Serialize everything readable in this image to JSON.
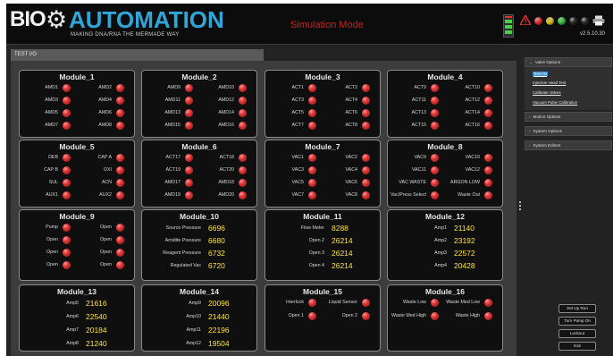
{
  "header": {
    "logo_bio": "BIO",
    "logo_automation": "AUTOMATION",
    "logo_tagline": "MAKING DNA/RNA THE MERMADE WAY",
    "mode": "Simulation Mode",
    "version": "v2.5.10.30",
    "status_colors": [
      "#e63030",
      "#e0c020",
      "#36c236",
      "#2a2a2a",
      "#2a2a2a"
    ]
  },
  "toolbar": {
    "tab_label": "TEST I/O"
  },
  "modules": [
    {
      "title": "Module_1",
      "rows": [
        [
          "AMD1",
          "AMD2"
        ],
        [
          "AMD3",
          "AMD4"
        ],
        [
          "AMD5",
          "AMD6"
        ],
        [
          "AMD7",
          "AMD8"
        ]
      ]
    },
    {
      "title": "Module_2",
      "rows": [
        [
          "AMD9",
          "AMD10"
        ],
        [
          "AMD11",
          "AMD12"
        ],
        [
          "AMD13",
          "AMD14"
        ],
        [
          "AMD15",
          "AMD16"
        ]
      ]
    },
    {
      "title": "Module_3",
      "rows": [
        [
          "ACT1",
          "ACT2"
        ],
        [
          "ACT3",
          "ACT4"
        ],
        [
          "ACT5",
          "ACT6"
        ],
        [
          "ACT7",
          "ACT8"
        ]
      ]
    },
    {
      "title": "Module_4",
      "rows": [
        [
          "ACT9",
          "ACT10"
        ],
        [
          "ACT11",
          "ACT12"
        ],
        [
          "ACT13",
          "ACT14"
        ],
        [
          "ACT15",
          "ACT16"
        ]
      ]
    },
    {
      "title": "Module_5",
      "rows": [
        [
          "DEB",
          "CAP A"
        ],
        [
          "CAP B",
          "OXI"
        ],
        [
          "SUL",
          "ACN"
        ],
        [
          "AUX1",
          "AUX2"
        ]
      ]
    },
    {
      "title": "Module_6",
      "rows": [
        [
          "ACT17",
          "ACT18"
        ],
        [
          "ACT19",
          "ACT20"
        ],
        [
          "AMD17",
          "AMD18"
        ],
        [
          "AMD19",
          "AMD20"
        ]
      ]
    },
    {
      "title": "Module_7",
      "rows": [
        [
          "VAC1",
          "VAC2"
        ],
        [
          "VAC3",
          "VAC4"
        ],
        [
          "VAC5",
          "VAC6"
        ],
        [
          "VAC7",
          "VAC8"
        ]
      ]
    },
    {
      "title": "Module_8",
      "rows": [
        [
          "VAC9",
          "VAC10"
        ],
        [
          "VAC11",
          "VAC12"
        ],
        [
          "VAC WASTE",
          "ARGON LOW"
        ],
        [
          "Vac/Press Select",
          "Waste Out"
        ]
      ]
    },
    {
      "title": "Module_9",
      "rows": [
        [
          "Pump",
          "Open"
        ],
        [
          "Open",
          "Open"
        ],
        [
          "Open",
          "Open"
        ],
        [
          "Open",
          "Open"
        ]
      ]
    },
    {
      "title": "Module_10",
      "readings": [
        [
          "Source Pressure",
          "6696"
        ],
        [
          "Amidite Pressure",
          "6680"
        ],
        [
          "Reagent Pressure",
          "6732"
        ],
        [
          "Regulated Vac",
          "6720"
        ]
      ]
    },
    {
      "title": "Module_11",
      "readings": [
        [
          "Flow Meter",
          "8288"
        ],
        [
          "Open 2",
          "26214"
        ],
        [
          "Open 3",
          "26214"
        ],
        [
          "Open 4",
          "26214"
        ]
      ]
    },
    {
      "title": "Module_12",
      "readings": [
        [
          "Amp1",
          "21140"
        ],
        [
          "Amp2",
          "23192"
        ],
        [
          "Amp3",
          "22572"
        ],
        [
          "Amp4",
          "20428"
        ]
      ]
    },
    {
      "title": "Module_13",
      "readings": [
        [
          "Amp5",
          "21616"
        ],
        [
          "Amp6",
          "22540"
        ],
        [
          "Amp7",
          "20184"
        ],
        [
          "Amp8",
          "21240"
        ]
      ]
    },
    {
      "title": "Module_14",
      "readings": [
        [
          "Amp9",
          "20096"
        ],
        [
          "Amp10",
          "21440"
        ],
        [
          "Amp11",
          "22196"
        ],
        [
          "Amp12",
          "19504"
        ]
      ]
    },
    {
      "title": "Module_15",
      "rows": [
        [
          "Interlock",
          "Liquid Sensor"
        ],
        [
          "Open 1",
          "Open 2"
        ]
      ]
    },
    {
      "title": "Module_16",
      "rows": [
        [
          "Waste Low",
          "Waste Med Low"
        ],
        [
          "Waste Med High",
          "Waste High"
        ]
      ]
    }
  ],
  "side_panel": {
    "sections": [
      "Valve Options",
      "Motion Options",
      "System Options",
      "System Editors"
    ],
    "valve_items": [
      "Test I/O",
      "Injection Head Test",
      "Calibrate Valves",
      "Vacuum Pulse Calibration"
    ]
  },
  "buttons": [
    "Set Up Run",
    "Turn Pump On",
    "Lockout",
    "Exit"
  ]
}
